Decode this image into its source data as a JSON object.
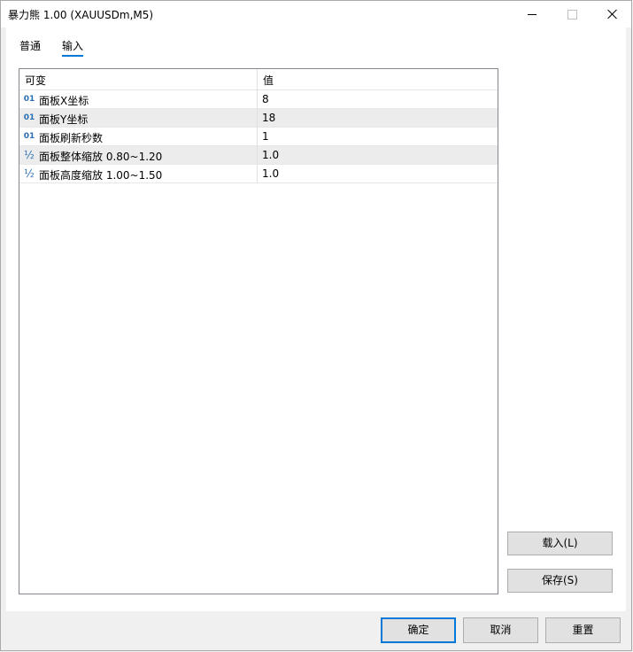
{
  "window": {
    "title": "暴力熊 1.00 (XAUUSDm,M5)"
  },
  "tabs": [
    {
      "label": "普通",
      "selected": false
    },
    {
      "label": "输入",
      "selected": true
    }
  ],
  "grid": {
    "columns": {
      "name": "可变",
      "value": "值"
    },
    "rows": [
      {
        "type": "01",
        "name": "面板X坐标",
        "value": "8"
      },
      {
        "type": "01",
        "name": "面板Y坐标",
        "value": "18"
      },
      {
        "type": "01",
        "name": "面板刷新秒数",
        "value": "1"
      },
      {
        "type": "½",
        "name": "面板整体缩放 0.80~1.20",
        "value": "1.0"
      },
      {
        "type": "½",
        "name": "面板高度缩放 1.00~1.50",
        "value": "1.0"
      }
    ]
  },
  "side_buttons": {
    "load": "载入(L)",
    "save": "保存(S)"
  },
  "footer_buttons": {
    "ok": "确定",
    "cancel": "取消",
    "reset": "重置"
  },
  "colors": {
    "accent": "#0078d7",
    "type_icon": "#2b6fb3"
  }
}
